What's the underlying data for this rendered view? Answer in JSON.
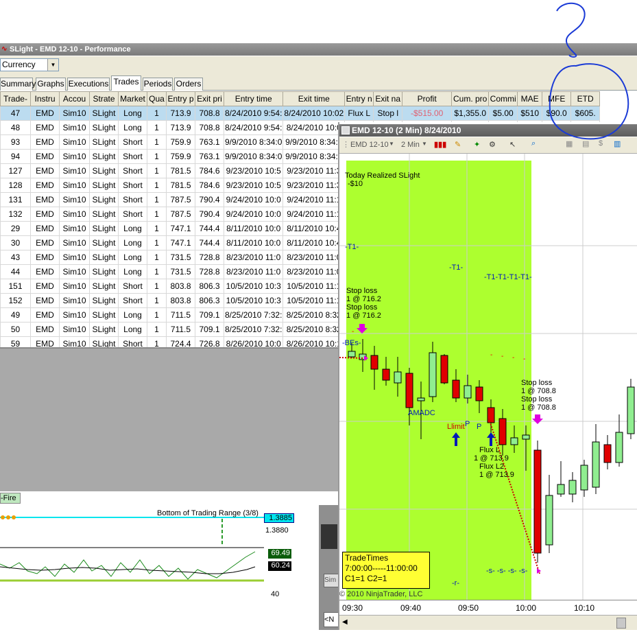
{
  "perf_window": {
    "title": "SLight - EMD 12-10 - Performance",
    "currency_select": "Currency",
    "tabs": [
      "Summary",
      "Graphs",
      "Executions",
      "Trades",
      "Periods",
      "Orders"
    ],
    "active_tab": "Trades"
  },
  "trades_table": {
    "columns": [
      "Trade-",
      "Instru",
      "Accou",
      "Strate",
      "Market",
      "Qua",
      "Entry p",
      "Exit pri",
      "Entry time",
      "Exit time",
      "Entry n",
      "Exit na",
      "Profit",
      "Cum. pro",
      "Commi",
      "MAE",
      "MFE",
      "ETD"
    ],
    "selected_row": {
      "trade": "47",
      "instrument": "EMD",
      "account": "Sim10",
      "strategy": "SLight",
      "market": "Long",
      "qty": "1",
      "entry_price": "713.9",
      "exit_price": "708.8",
      "entry_time": "8/24/2010 9:54:",
      "exit_time": "8/24/2010 10:02",
      "entry_name": "Flux L",
      "exit_name": "Stop l",
      "profit": "-$515.00",
      "cum_profit": "$1,355.0",
      "commission": "$5.00",
      "mae": "$510",
      "mfe": "$90.0",
      "etd": "$605."
    },
    "rows": [
      [
        "48",
        "EMD",
        "Sim10",
        "SLight",
        "Long",
        "1",
        "713.9",
        "708.8",
        "8/24/2010 9:54:",
        "8/24/2010 10:0"
      ],
      [
        "93",
        "EMD",
        "Sim10",
        "SLight",
        "Short",
        "1",
        "759.9",
        "763.1",
        "9/9/2010 8:34:0",
        "9/9/2010 8:34:0"
      ],
      [
        "94",
        "EMD",
        "Sim10",
        "SLight",
        "Short",
        "1",
        "759.9",
        "763.1",
        "9/9/2010 8:34:0",
        "9/9/2010 8:34:0"
      ],
      [
        "127",
        "EMD",
        "Sim10",
        "SLight",
        "Short",
        "1",
        "781.5",
        "784.6",
        "9/23/2010 10:5",
        "9/23/2010 11:3"
      ],
      [
        "128",
        "EMD",
        "Sim10",
        "SLight",
        "Short",
        "1",
        "781.5",
        "784.6",
        "9/23/2010 10:5",
        "9/23/2010 11:3"
      ],
      [
        "131",
        "EMD",
        "Sim10",
        "SLight",
        "Short",
        "1",
        "787.5",
        "790.4",
        "9/24/2010 10:0",
        "9/24/2010 11:1"
      ],
      [
        "132",
        "EMD",
        "Sim10",
        "SLight",
        "Short",
        "1",
        "787.5",
        "790.4",
        "9/24/2010 10:0",
        "9/24/2010 11:1"
      ],
      [
        "29",
        "EMD",
        "Sim10",
        "SLight",
        "Long",
        "1",
        "747.1",
        "744.4",
        "8/11/2010 10:0",
        "8/11/2010 10:4"
      ],
      [
        "30",
        "EMD",
        "Sim10",
        "SLight",
        "Long",
        "1",
        "747.1",
        "744.4",
        "8/11/2010 10:0",
        "8/11/2010 10:4"
      ],
      [
        "43",
        "EMD",
        "Sim10",
        "SLight",
        "Long",
        "1",
        "731.5",
        "728.8",
        "8/23/2010 11:0",
        "8/23/2010 11:0"
      ],
      [
        "44",
        "EMD",
        "Sim10",
        "SLight",
        "Long",
        "1",
        "731.5",
        "728.8",
        "8/23/2010 11:0",
        "8/23/2010 11:0"
      ],
      [
        "151",
        "EMD",
        "Sim10",
        "SLight",
        "Short",
        "1",
        "803.8",
        "806.3",
        "10/5/2010 10:3",
        "10/5/2010 11:1"
      ],
      [
        "152",
        "EMD",
        "Sim10",
        "SLight",
        "Short",
        "1",
        "803.8",
        "806.3",
        "10/5/2010 10:3",
        "10/5/2010 11:1"
      ],
      [
        "49",
        "EMD",
        "Sim10",
        "SLight",
        "Long",
        "1",
        "711.5",
        "709.1",
        "8/25/2010 7:32:",
        "8/25/2010 8:32"
      ],
      [
        "50",
        "EMD",
        "Sim10",
        "SLight",
        "Long",
        "1",
        "711.5",
        "709.1",
        "8/25/2010 7:32:",
        "8/25/2010 8:32"
      ],
      [
        "59",
        "EMD",
        "Sim10",
        "SLight",
        "Short",
        "1",
        "724.4",
        "726.8",
        "8/26/2010 10:0",
        "8/26/2010 10:1"
      ]
    ]
  },
  "indicator_pane": {
    "tab_label": "-Fire",
    "range_label": "Bottom of Trading Range (3/8)",
    "price_badge": "1.3885",
    "price_tick": "1.3880",
    "osc_badge_1": "69.49",
    "osc_badge_2": "60.24",
    "osc_tick": "40"
  },
  "chart_window": {
    "title": "EMD 12-10 (2 Min)  8/24/2010",
    "instrument_select": "EMD 12-10",
    "interval_select": "2 Min",
    "realized_label": "Today Realized SLight",
    "realized_value": "-$10",
    "tradetimes_title": "TradeTimes",
    "tradetimes_range": "7:00:00-----11:00:00",
    "tradetimes_counts": "C1=1  C2=1",
    "copyright": "© 2010 NinjaTrader, LLC",
    "x_labels": [
      "09:30",
      "09:40",
      "09:50",
      "10:00",
      "10:10"
    ],
    "annotations": {
      "t1_a": "-T1-",
      "t1_b": "-T1-",
      "t1_c": "-T1-T1-T1-T1-",
      "stop1": "Stop loss",
      "stop1_q": "1 @ 716.2",
      "stop2": "Stop loss",
      "stop2_q": "1 @ 716.2",
      "bes": "-BEs-",
      "amadc": "AMADC",
      "llimit": "Llimit",
      "p1": "P",
      "p2": "P",
      "flux1": "Flux L",
      "flux1_q": "1 @ 713.9",
      "flux2": "Flux L2",
      "flux2_q": "1 @ 713.9",
      "stop3": "Stop loss",
      "stop3_q": "1 @ 708.8",
      "stop4": "Stop loss",
      "stop4_q": "1 @ 708.8",
      "r_mark": "-r-",
      "s_marks": "-s-  -s-  -s-  -s-"
    }
  },
  "colors": {
    "session_highlight": "#adff2f",
    "up_candle": "#90ee90",
    "down_candle": "#e00000",
    "annotation_circle": "#1a3ad6"
  }
}
